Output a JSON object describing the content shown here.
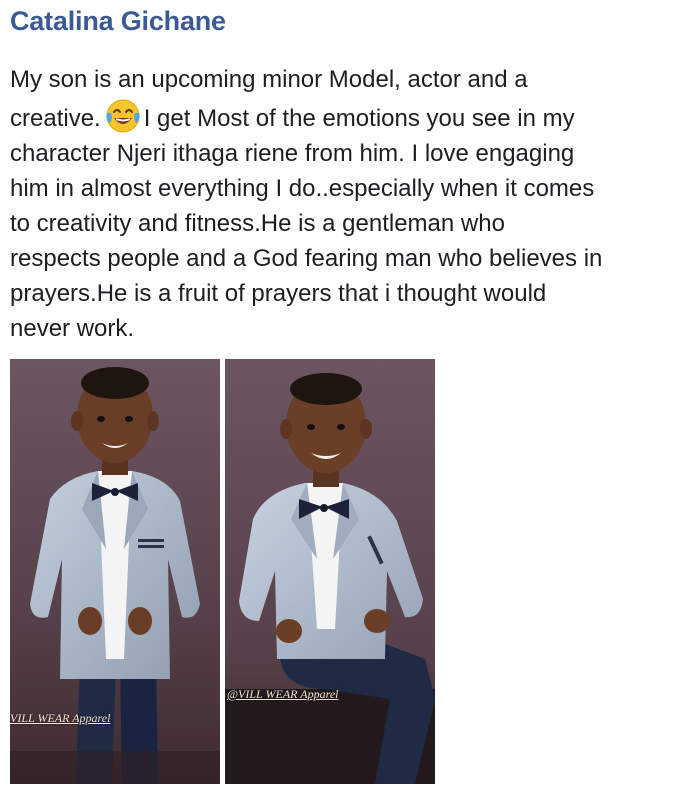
{
  "post": {
    "author": "Catalina Gichane",
    "text_lines": [
      "My son is an upcoming minor Model, actor and a",
      "creative.",
      "I get Most of the emotions you see in my",
      "character Njeri ithaga riene from him. I love engaging",
      "him in almost everything I do..especially  when it comes",
      "to creativity and fitness.He  is a gentleman who",
      "respects people and a God fearing man who believes in",
      "prayers.He  is a fruit of prayers that i thought would",
      "never work."
    ],
    "emoji": "face-with-tears-of-joy-icon"
  },
  "photos": [
    {
      "name": "boy-standing-photo",
      "watermark": "VILL WEAR Apparel"
    },
    {
      "name": "boy-seated-photo",
      "watermark": "@VILL WEAR Apparel"
    }
  ],
  "colors": {
    "author": "#3b5998",
    "text": "#1c1e21",
    "backdrop": "#5a4450",
    "jacket": "#a9b6c6",
    "trousers": "#1f2a44"
  }
}
